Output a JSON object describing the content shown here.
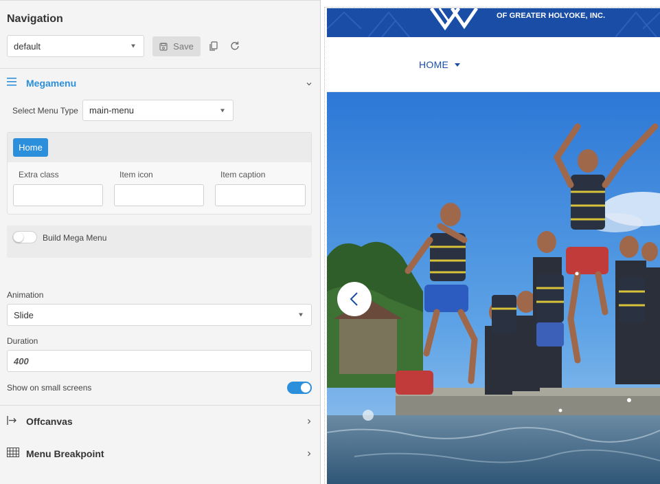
{
  "panel": {
    "title": "Navigation",
    "menu_select": {
      "value": "default"
    },
    "save_label": "Save"
  },
  "megamenu": {
    "title": "Megamenu",
    "menu_type_label": "Select Menu Type",
    "menu_type_value": "main-menu",
    "active_item": "Home",
    "fields": {
      "extra_class_label": "Extra class",
      "item_icon_label": "Item icon",
      "item_caption_label": "Item caption"
    },
    "build_mega_menu_label": "Build Mega Menu",
    "build_mega_menu_on": false,
    "animation_label": "Animation",
    "animation_value": "Slide",
    "duration_label": "Duration",
    "duration_value": "400",
    "small_screens_label": "Show on small screens",
    "small_screens_on": true
  },
  "sections": {
    "offcanvas": "Offcanvas",
    "breakpoint": "Menu Breakpoint"
  },
  "preview": {
    "org_name": "OF GREATER HOLYOKE, INC.",
    "nav_home": "HOME"
  },
  "colors": {
    "accent": "#2b8fdc",
    "brand_blue": "#1a4ea6",
    "panel_bg": "#f4f4f4"
  }
}
